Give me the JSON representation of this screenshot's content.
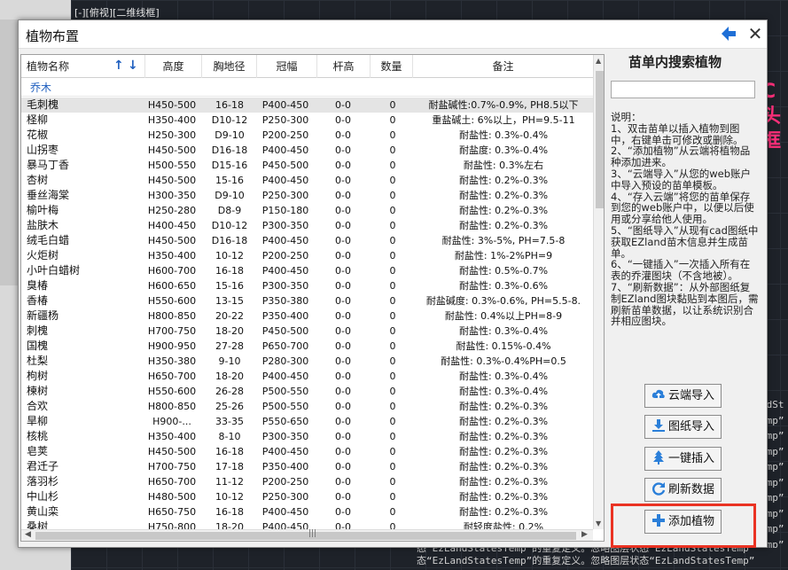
{
  "background": {
    "top_label": "[-][俯视][二维线框]",
    "right_red_text": "C\n头\n框",
    "console_lines": [
      "态“EzLandStatesTemp”的重复定义。忽略图层状态“EzLandStatesTemp”",
      "态“EzLandStatesTemp”的重复定义。忽略图层状态“EzLandStatesTemp”"
    ],
    "console_right_lines": [
      "ndSt",
      "emp”",
      "emp”",
      "emp”",
      "emp”",
      "emp”",
      "emp”",
      "emp”",
      "emp”",
      "emp”"
    ]
  },
  "dialog": {
    "title": "植物布置"
  },
  "table": {
    "columns": [
      "植物名称",
      "高度",
      "胸地径",
      "冠幅",
      "杆高",
      "数量",
      "备注"
    ],
    "sort_up": "↑",
    "sort_down": "↓",
    "group": "乔木",
    "rows": [
      {
        "name": "毛刺槐",
        "height": "H450-500",
        "dbh": "16-18",
        "crown": "P400-450",
        "trunk": "0-0",
        "qty": "0",
        "note": "耐盐碱性:0.7%-0.9%, PH8.5以下"
      },
      {
        "name": "柽柳",
        "height": "H350-400",
        "dbh": "D10-12",
        "crown": "P250-300",
        "trunk": "0-0",
        "qty": "0",
        "note": "重盐碱土: 6%以上，PH=9.5-11"
      },
      {
        "name": "花椒",
        "height": "H250-300",
        "dbh": "D9-10",
        "crown": "P200-250",
        "trunk": "0-0",
        "qty": "0",
        "note": "耐盐性: 0.3%-0.4%"
      },
      {
        "name": "山拐枣",
        "height": "H450-500",
        "dbh": "D16-18",
        "crown": "P400-450",
        "trunk": "0-0",
        "qty": "0",
        "note": "耐盐度: 0.3%-0.4%"
      },
      {
        "name": "暴马丁香",
        "height": "H500-550",
        "dbh": "D15-16",
        "crown": "P450-500",
        "trunk": "0-0",
        "qty": "0",
        "note": "耐盐性: 0.3%左右"
      },
      {
        "name": "杏树",
        "height": "H450-500",
        "dbh": "15-16",
        "crown": "P400-450",
        "trunk": "0-0",
        "qty": "0",
        "note": "耐盐性: 0.2%-0.3%"
      },
      {
        "name": "垂丝海棠",
        "height": "H300-350",
        "dbh": "D9-10",
        "crown": "P250-300",
        "trunk": "0-0",
        "qty": "0",
        "note": "耐盐性: 0.2%-0.3%"
      },
      {
        "name": "榆叶梅",
        "height": "H250-280",
        "dbh": "D8-9",
        "crown": "P150-180",
        "trunk": "0-0",
        "qty": "0",
        "note": "耐盐性: 0.2%-0.3%"
      },
      {
        "name": "盐肤木",
        "height": "H400-450",
        "dbh": "D10-12",
        "crown": "P300-350",
        "trunk": "0-0",
        "qty": "0",
        "note": "耐盐性: 0.2%-0.3%"
      },
      {
        "name": "绒毛白蜡",
        "height": "H450-500",
        "dbh": "D16-18",
        "crown": "P400-450",
        "trunk": "0-0",
        "qty": "0",
        "note": "耐盐性: 3%-5%, PH=7.5-8"
      },
      {
        "name": "火炬树",
        "height": "H350-400",
        "dbh": "10-12",
        "crown": "P200-250",
        "trunk": "0-0",
        "qty": "0",
        "note": "耐盐性: 1%-2%PH=9"
      },
      {
        "name": "小叶白蜡树",
        "height": "H600-700",
        "dbh": "16-18",
        "crown": "P400-450",
        "trunk": "0-0",
        "qty": "0",
        "note": "耐盐性: 0.5%-0.7%"
      },
      {
        "name": "臭椿",
        "height": "H600-650",
        "dbh": "15-16",
        "crown": "P300-350",
        "trunk": "0-0",
        "qty": "0",
        "note": "耐盐性: 0.3%-0.6%"
      },
      {
        "name": "香椿",
        "height": "H550-600",
        "dbh": "13-15",
        "crown": "P350-380",
        "trunk": "0-0",
        "qty": "0",
        "note": "耐盐碱度: 0.3%-0.6%, PH=5.5-8."
      },
      {
        "name": "新疆杨",
        "height": "H800-850",
        "dbh": "20-22",
        "crown": "P350-400",
        "trunk": "0-0",
        "qty": "0",
        "note": "耐盐性: 0.4%以上PH=8-9"
      },
      {
        "name": "刺槐",
        "height": "H700-750",
        "dbh": "18-20",
        "crown": "P450-500",
        "trunk": "0-0",
        "qty": "0",
        "note": "耐盐性: 0.3%-0.4%"
      },
      {
        "name": "国槐",
        "height": "H900-950",
        "dbh": "27-28",
        "crown": "P650-700",
        "trunk": "0-0",
        "qty": "0",
        "note": "耐盐性: 0.15%-0.4%"
      },
      {
        "name": "杜梨",
        "height": "H350-380",
        "dbh": "9-10",
        "crown": "P280-300",
        "trunk": "0-0",
        "qty": "0",
        "note": "耐盐性: 0.3%-0.4%PH=0.5"
      },
      {
        "name": "枸树",
        "height": "H650-700",
        "dbh": "18-20",
        "crown": "P400-450",
        "trunk": "0-0",
        "qty": "0",
        "note": "耐盐性: 0.3%-0.4%"
      },
      {
        "name": "楝树",
        "height": "H550-600",
        "dbh": "26-28",
        "crown": "P500-550",
        "trunk": "0-0",
        "qty": "0",
        "note": "耐盐性: 0.3%-0.4%"
      },
      {
        "name": "合欢",
        "height": "H800-850",
        "dbh": "25-26",
        "crown": "P500-550",
        "trunk": "0-0",
        "qty": "0",
        "note": "耐盐性: 0.2%-0.3%"
      },
      {
        "name": "旱柳",
        "height": "H900-...",
        "dbh": "33-35",
        "crown": "P550-650",
        "trunk": "0-0",
        "qty": "0",
        "note": "耐盐性: 0.2%-0.3%"
      },
      {
        "name": "核桃",
        "height": "H350-400",
        "dbh": "8-10",
        "crown": "P300-350",
        "trunk": "0-0",
        "qty": "0",
        "note": "耐盐性: 0.2%-0.3%"
      },
      {
        "name": "皂荚",
        "height": "H450-500",
        "dbh": "16-18",
        "crown": "P400-450",
        "trunk": "0-0",
        "qty": "0",
        "note": "耐盐性: 0.2%-0.3%"
      },
      {
        "name": "君迁子",
        "height": "H700-750",
        "dbh": "17-18",
        "crown": "P350-400",
        "trunk": "0-0",
        "qty": "0",
        "note": "耐盐性: 0.2%-0.3%"
      },
      {
        "name": "落羽杉",
        "height": "H650-700",
        "dbh": "11-12",
        "crown": "P200-250",
        "trunk": "0-0",
        "qty": "0",
        "note": "耐盐性: 0.2%-0.3%"
      },
      {
        "name": "中山杉",
        "height": "H480-500",
        "dbh": "10-12",
        "crown": "P250-300",
        "trunk": "0-0",
        "qty": "0",
        "note": "耐盐性: 0.2%-0.3%"
      },
      {
        "name": "黄山栾",
        "height": "H650-750",
        "dbh": "16-18",
        "crown": "P400-450",
        "trunk": "0-0",
        "qty": "0",
        "note": "耐盐性: 0.2%-0.3%"
      },
      {
        "name": "桑树",
        "height": "H750-800",
        "dbh": "18-20",
        "crown": "P400-450",
        "trunk": "0-0",
        "qty": "0",
        "note": "耐轻度盐性: 0.2%"
      }
    ],
    "selected_row": 0,
    "hscroll_grip": "|||"
  },
  "panel": {
    "search_title": "苗单内搜索植物",
    "search_value": "",
    "help_lines": [
      "说明：",
      "1、双击苗单以插入植物到图中，右键单击可修改或删除。",
      "2、“添加植物”从云端将植物品种添加进来。",
      "3、“云端导入”从您的web账户中导入预设的苗单模板。",
      "4、“存入云端”将您的苗单保存到您的web账户中，以便以后使用或分享给他人使用。",
      "5、“图纸导入”从现有cad图纸中获取EZland苗木信息并生成苗单。",
      "6、“一键插入”一次插入所有在表的乔灌图块（不含地被）。",
      "7、“刷新数据”：从外部图纸复制EZland图块黏贴到本图后，需刷新苗单数据，以让系统识别合并相应图块。"
    ],
    "buttons": {
      "cloud_import": "云端导入",
      "drawing_import": "图纸导入",
      "one_click_insert": "一键插入",
      "refresh": "刷新数据",
      "add_plant": "添加植物"
    }
  },
  "colors": {
    "accent_blue": "#1f6fd6",
    "highlight_red": "#ea3323",
    "group_blue": "#1f5fbf"
  }
}
